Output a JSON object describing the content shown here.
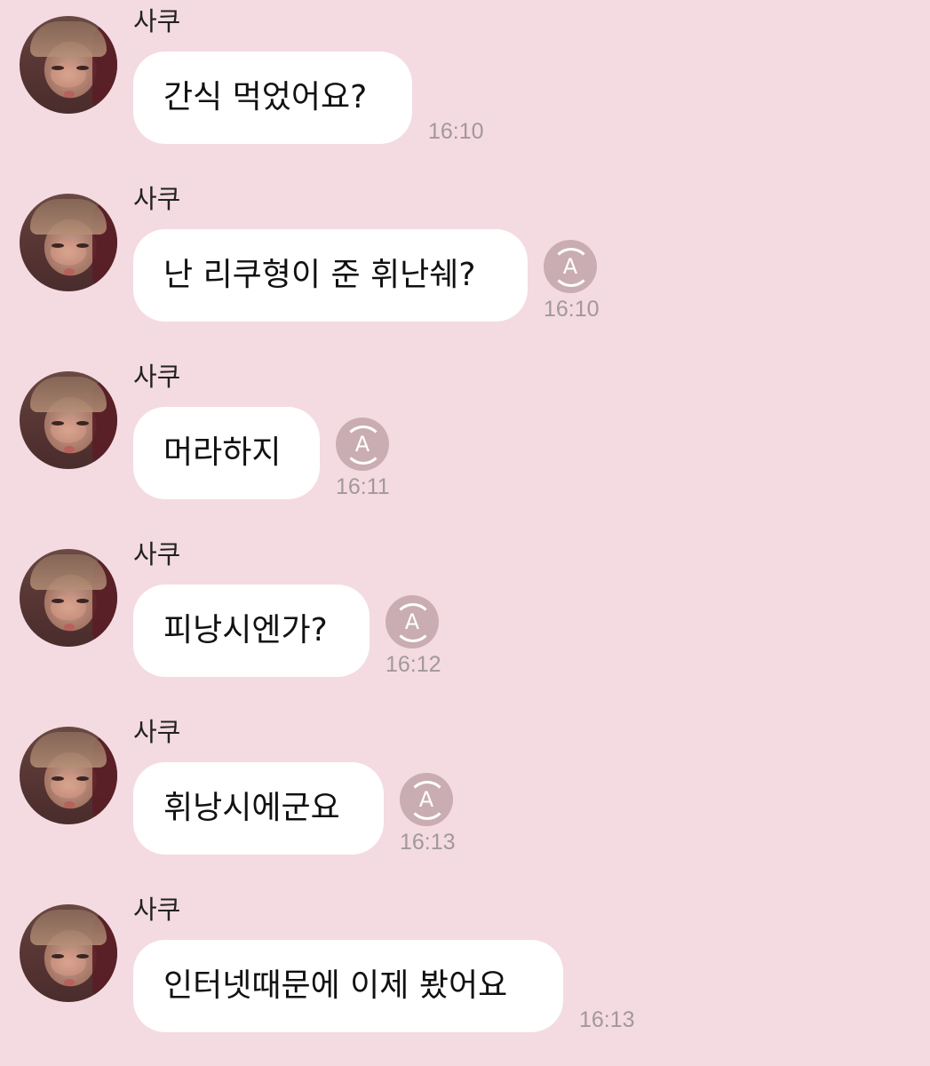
{
  "messages": [
    {
      "sender": "사쿠",
      "text": "간식 먹었어요?",
      "time": "16:10",
      "translate": false
    },
    {
      "sender": "사쿠",
      "text": "난 리쿠형이 준 휘난쉐?",
      "time": "16:10",
      "translate": true,
      "translate_icon": "translate-icon",
      "translate_letter": "A"
    },
    {
      "sender": "사쿠",
      "text": "머라하지",
      "time": "16:11",
      "translate": true,
      "translate_icon": "translate-icon",
      "translate_letter": "A"
    },
    {
      "sender": "사쿠",
      "text": "피낭시엔가?",
      "time": "16:12",
      "translate": true,
      "translate_icon": "translate-icon",
      "translate_letter": "A"
    },
    {
      "sender": "사쿠",
      "text": "휘낭시에군요",
      "time": "16:13",
      "translate": true,
      "translate_icon": "translate-icon",
      "translate_letter": "A"
    },
    {
      "sender": "사쿠",
      "text": "인터넷때문에 이제 봤어요",
      "time": "16:13",
      "translate": false
    }
  ],
  "colors": {
    "background": "#f4dbe1",
    "bubble": "#ffffff",
    "timestamp": "#a2989b",
    "translate_button": "#c9adb3"
  }
}
